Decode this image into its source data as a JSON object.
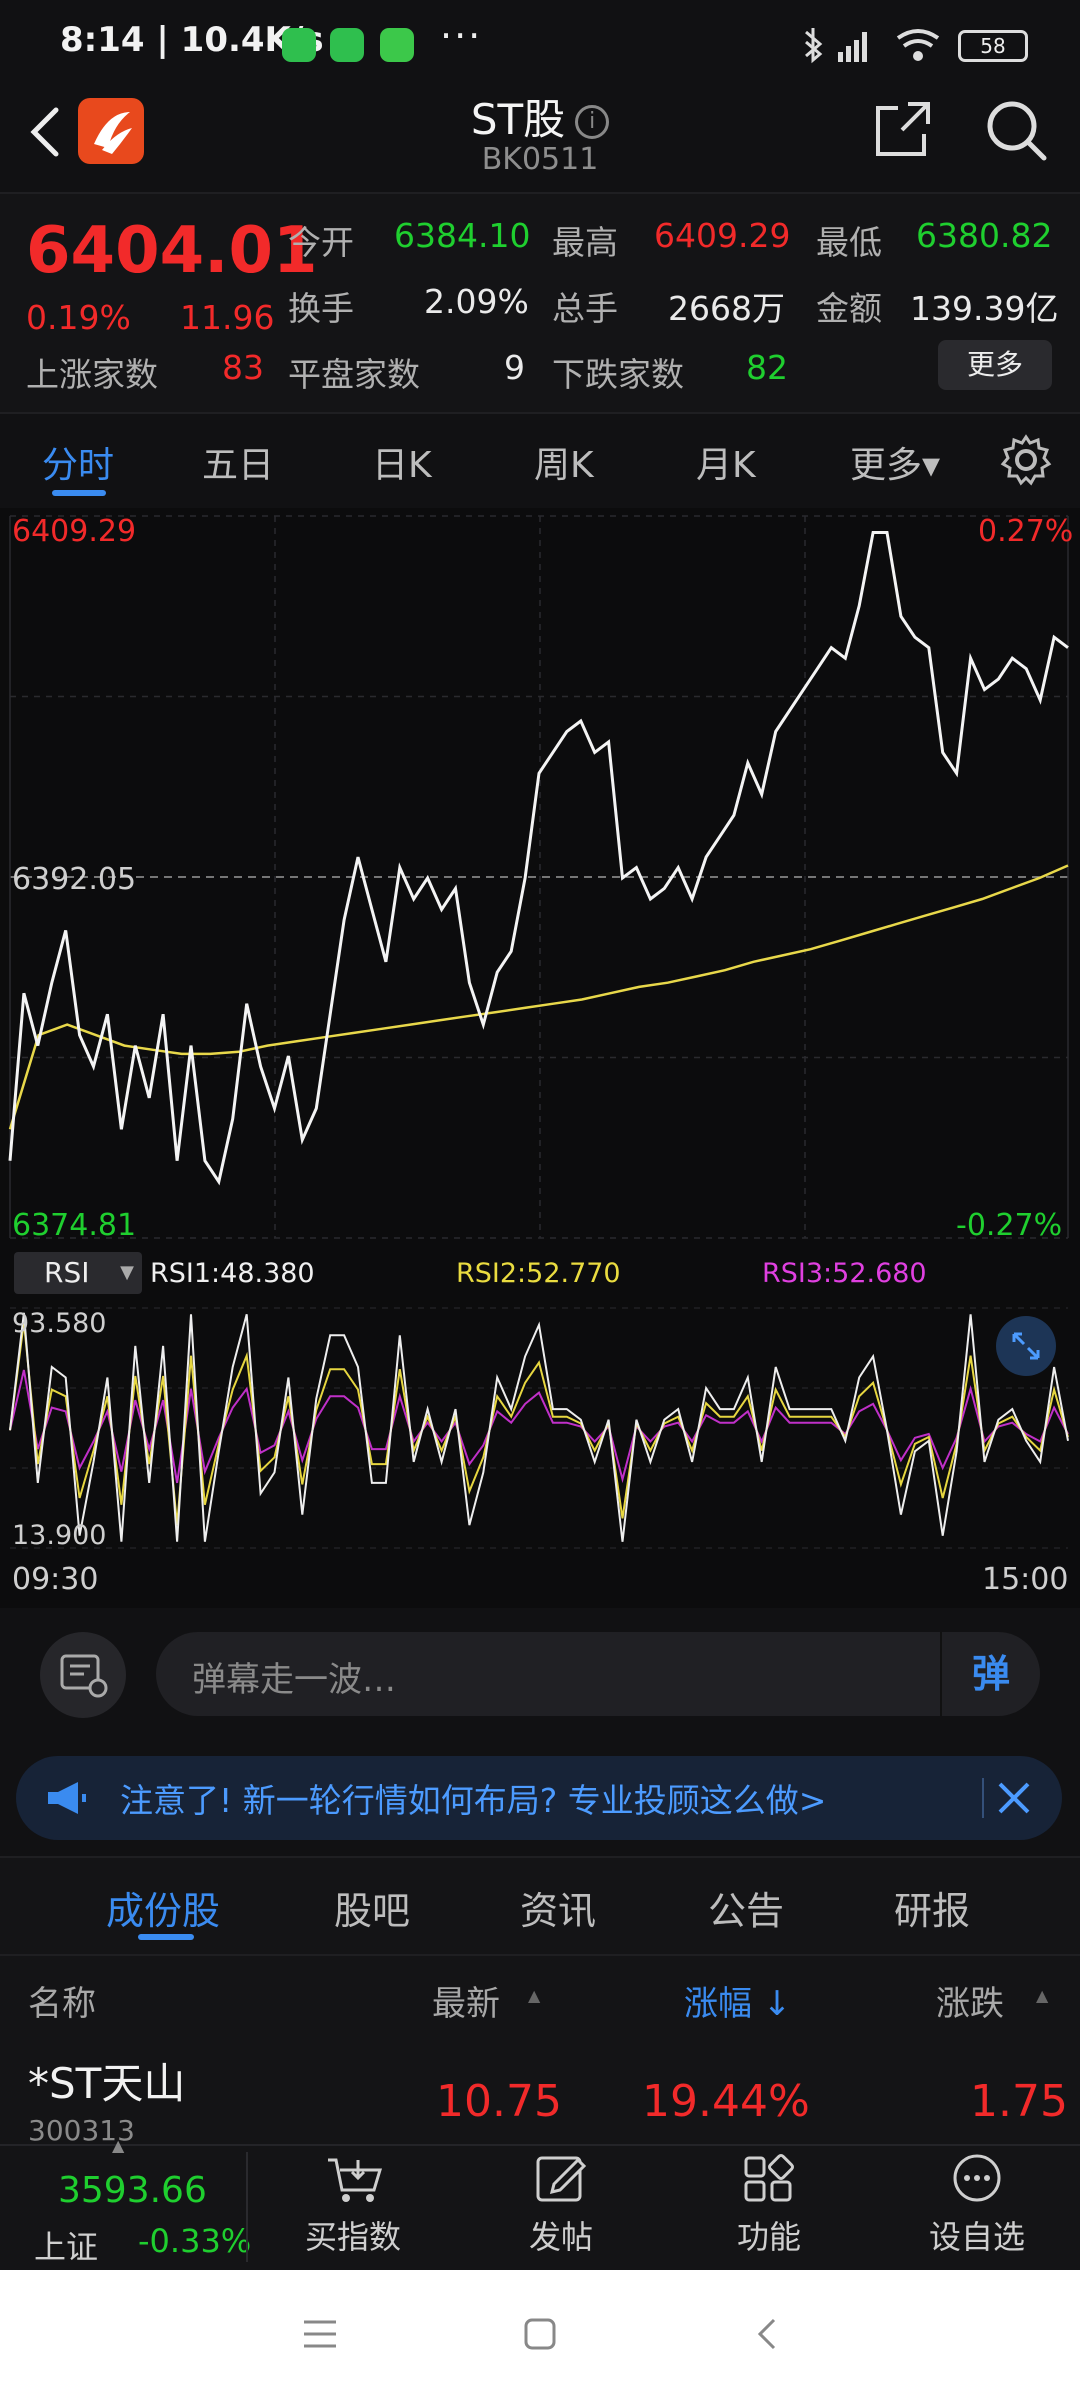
{
  "status_bar": {
    "time": "8:14 | 10.4K/s",
    "more": "···",
    "battery": "58"
  },
  "header": {
    "title": "ST股",
    "info_glyph": "i",
    "code": "BK0511"
  },
  "summary": {
    "price": "6404.01",
    "change_pct": "0.19%",
    "change": "11.96",
    "open_label": "今开",
    "open": "6384.10",
    "high_label": "最高",
    "high": "6409.29",
    "low_label": "最低",
    "low": "6380.82",
    "turnover_label": "换手",
    "turnover": "2.09%",
    "volume_label": "总手",
    "volume": "2668万",
    "amount_label": "金额",
    "amount": "139.39亿",
    "up_label": "上涨家数",
    "up": "83",
    "flat_label": "平盘家数",
    "flat": "9",
    "down_label": "下跌家数",
    "down": "82",
    "more_button": "更多"
  },
  "period_tabs": [
    "分时",
    "五日",
    "日K",
    "周K",
    "月K",
    "更多▾"
  ],
  "period_active": 0,
  "chart_labels": {
    "top_left": "6409.29",
    "top_right": "0.27%",
    "mid_left": "6392.05",
    "bottom_left": "6374.81",
    "bottom_right": "-0.27%",
    "rsi_tag": "RSI",
    "rsi1": "RSI1:48.380",
    "rsi2": "RSI2:52.770",
    "rsi3": "RSI3:52.680",
    "rsi_top": "93.580",
    "rsi_bottom": "13.900",
    "time_start": "09:30",
    "time_end": "15:00"
  },
  "chart_data": {
    "type": "line",
    "title": "",
    "x": [
      "09:30",
      "15:00"
    ],
    "ylim": [
      6374.81,
      6409.29
    ],
    "prev_close": 6392.05,
    "series": [
      {
        "name": "price",
        "values": [
          6378.5,
          6386.5,
          6384.0,
          6387.0,
          6389.5,
          6384.5,
          6383.0,
          6385.5,
          6380.0,
          6384.0,
          6381.5,
          6385.5,
          6378.5,
          6384.0,
          6378.5,
          6377.5,
          6380.5,
          6386.0,
          6383.0,
          6381.0,
          6383.5,
          6379.5,
          6381.0,
          6385.5,
          6390.0,
          6393.0,
          6390.5,
          6388.0,
          6392.5,
          6391.0,
          6392.0,
          6390.5,
          6391.5,
          6387.0,
          6385.0,
          6387.5,
          6388.5,
          6392.0,
          6397.0,
          6398.0,
          6399.0,
          6399.5,
          6398.0,
          6398.5,
          6392.0,
          6392.5,
          6391.0,
          6391.5,
          6392.5,
          6391.0,
          6393.0,
          6394.0,
          6395.0,
          6397.5,
          6396.0,
          6399.0,
          6400.0,
          6401.0,
          6402.0,
          6403.0,
          6402.5,
          6405.0,
          6408.5,
          6408.5,
          6404.5,
          6403.5,
          6403.0,
          6398.0,
          6397.0,
          6402.5,
          6401.0,
          6401.5,
          6402.5,
          6402.0,
          6400.5,
          6403.5,
          6403.0
        ]
      },
      {
        "name": "avg",
        "values": [
          6380.0,
          6384.5,
          6385.0,
          6384.5,
          6384.0,
          6383.8,
          6383.6,
          6383.6,
          6383.7,
          6384.0,
          6384.2,
          6384.4,
          6384.6,
          6384.8,
          6385.0,
          6385.2,
          6385.4,
          6385.6,
          6385.8,
          6386.0,
          6386.2,
          6386.5,
          6386.8,
          6387.0,
          6387.3,
          6387.6,
          6388.0,
          6388.3,
          6388.6,
          6389.0,
          6389.4,
          6389.8,
          6390.2,
          6390.6,
          6391.0,
          6391.5,
          6392.0,
          6392.6
        ]
      }
    ]
  },
  "danmaku": {
    "placeholder": "弹幕走一波…",
    "send": "弹"
  },
  "notice": {
    "text": "注意了! 新一轮行情如何布局? 专业投顾这么做>"
  },
  "content_tabs": [
    "成份股",
    "股吧",
    "资讯",
    "公告",
    "研报"
  ],
  "list": {
    "headers": {
      "name": "名称",
      "latest": "最新",
      "change_pct": "涨幅",
      "change": "涨跌"
    },
    "rows": [
      {
        "name": "*ST天山",
        "code": "300313",
        "latest": "10.75",
        "change_pct": "19.44%",
        "change": "1.75"
      }
    ]
  },
  "bottom_bar": {
    "index_value": "3593.66",
    "index_name": "上证",
    "index_change": "-0.33%",
    "items": [
      "买指数",
      "发帖",
      "功能",
      "设自选"
    ]
  }
}
